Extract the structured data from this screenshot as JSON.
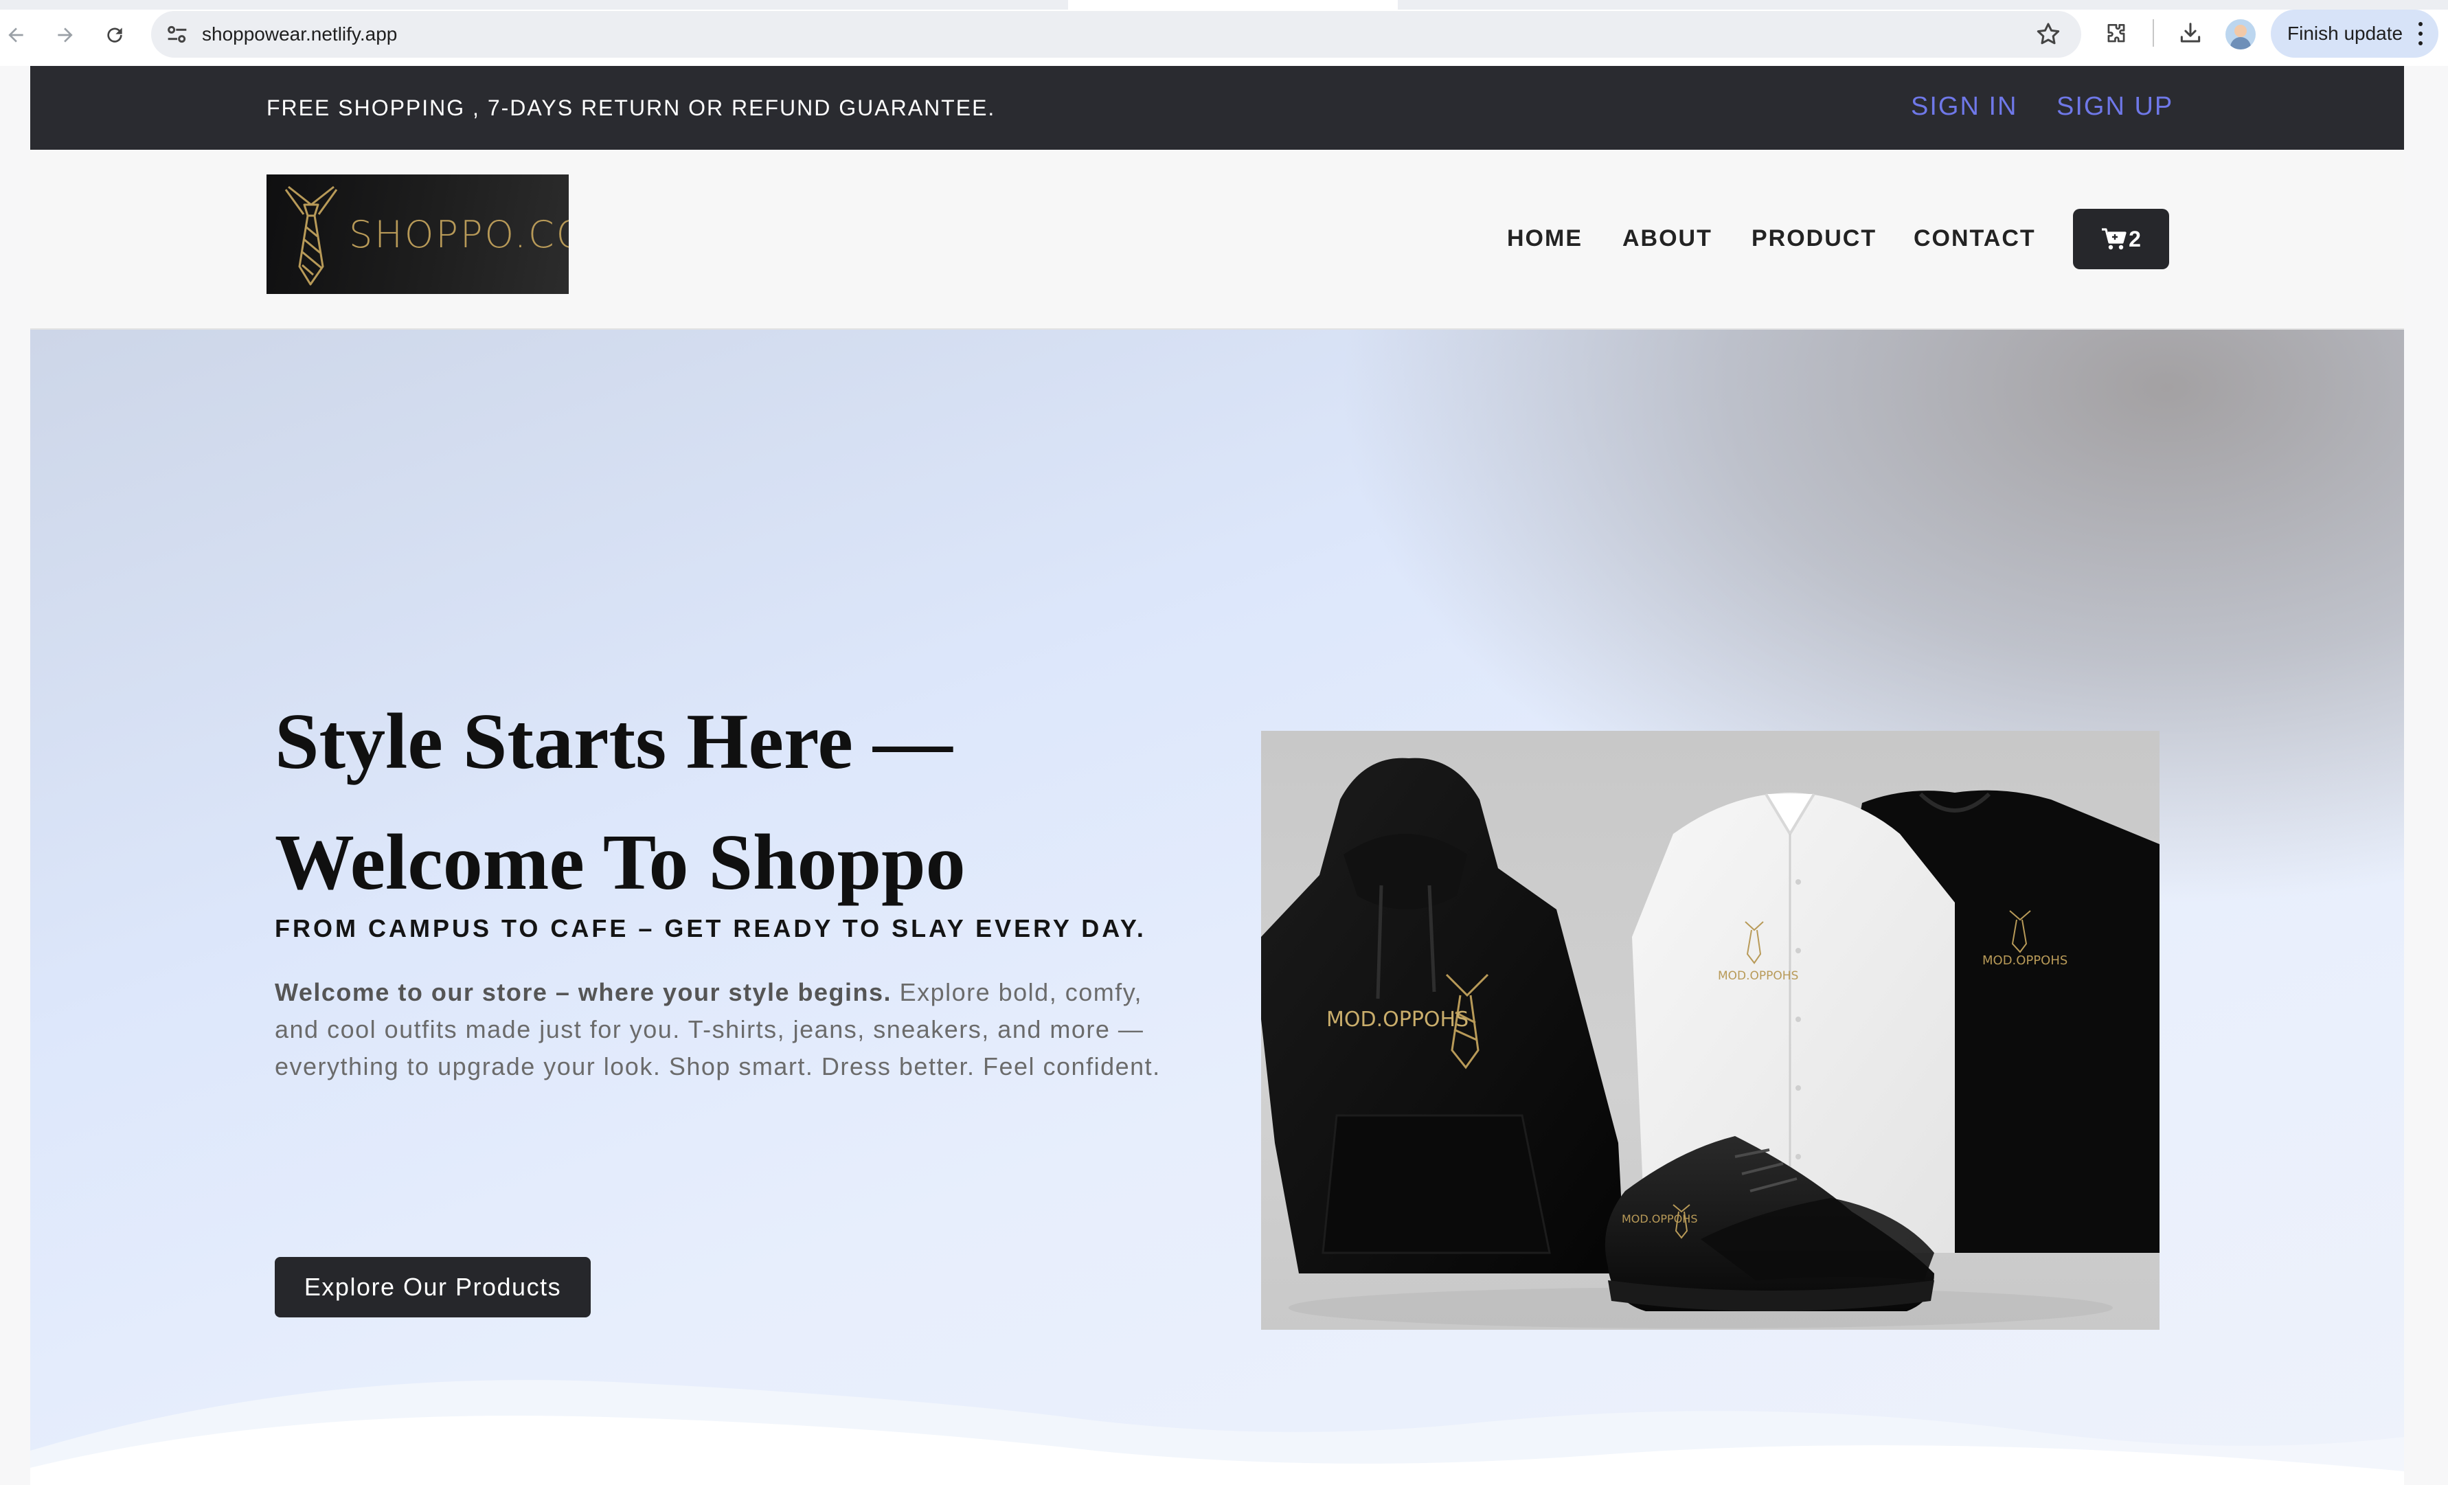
{
  "browser": {
    "url": "shoppowear.netlify.app",
    "update_button": "Finish update"
  },
  "topbar": {
    "promo_text": "FREE SHOPPING , 7-DAYS RETURN OR REFUND GUARANTEE.",
    "sign_in": "SIGN IN",
    "sign_up": "SIGN UP"
  },
  "header": {
    "logo_text": "SHOPPO.COM",
    "nav": [
      "HOME",
      "ABOUT",
      "PRODUCT",
      "CONTACT"
    ],
    "cart_count": "2"
  },
  "hero": {
    "title_line1": "Style Starts Here —",
    "title_line2": "Welcome To Shoppo",
    "subtitle": "FROM CAMPUS TO CAFE – GET READY TO SLAY EVERY DAY.",
    "description_bold": "Welcome to our store – where your style begins.",
    "description_rest": " Explore bold, comfy, and cool outfits made just for you. T-shirts, jeans, sneakers, and more — everything to upgrade your look. Shop smart. Dress better. Feel confident.",
    "cta": "Explore Our Products"
  },
  "colors": {
    "topbar_bg": "#2a2b30",
    "auth_link": "#6f78e8",
    "dark_button": "#26272b",
    "logo_gold": "#b89a58"
  },
  "icons": [
    "back-icon",
    "forward-icon",
    "reload-icon",
    "site-info-icon",
    "star-icon",
    "extensions-icon",
    "download-icon",
    "cart-icon",
    "tie-icon"
  ]
}
